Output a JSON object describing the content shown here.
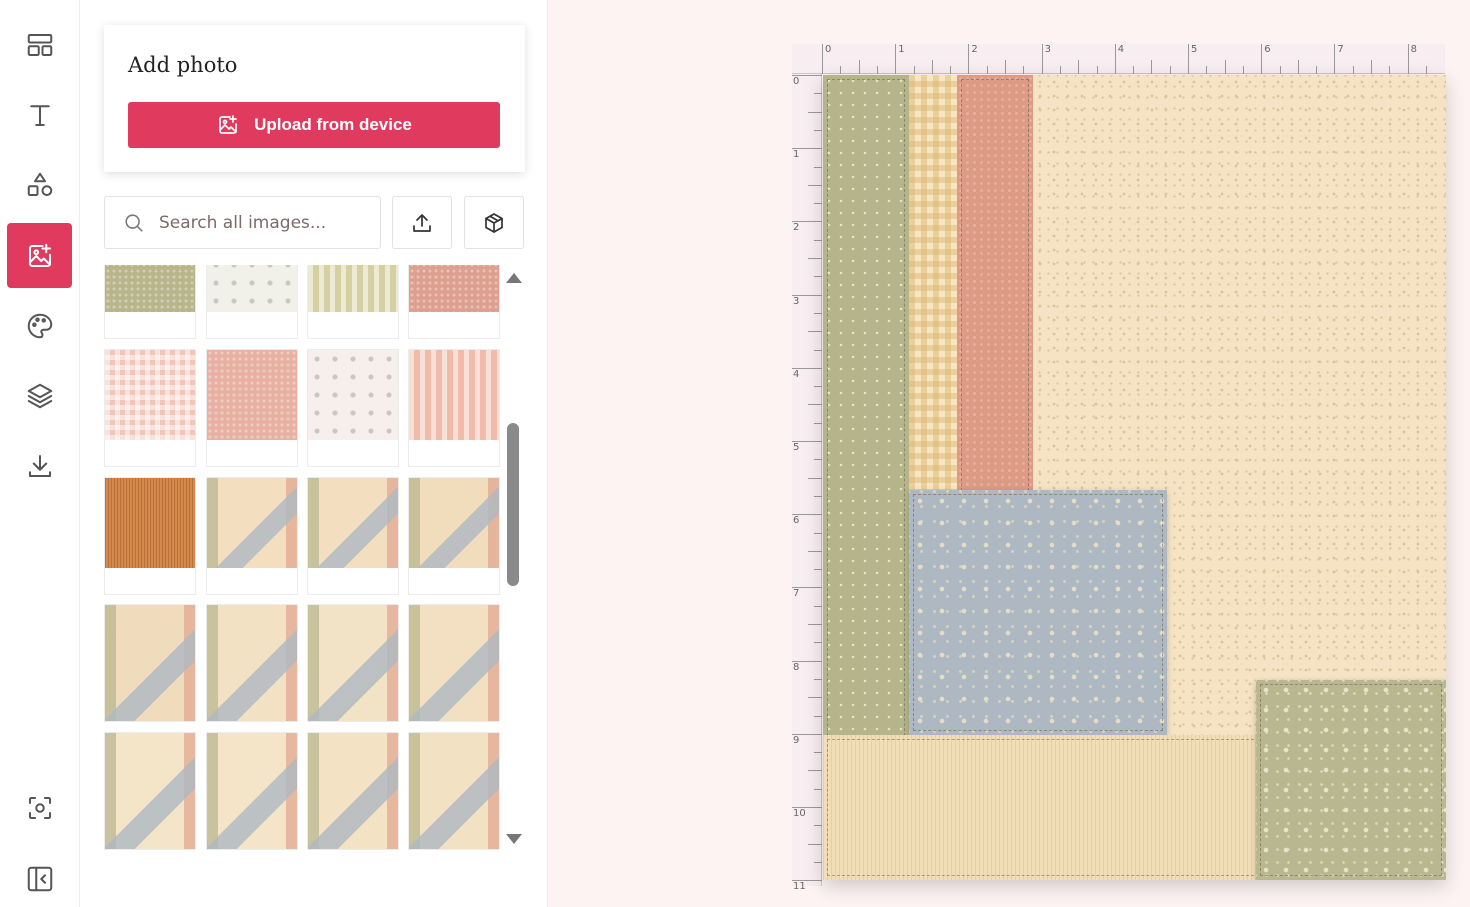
{
  "rail": {
    "items": [
      {
        "name": "templates",
        "icon": "layout-icon",
        "active": false
      },
      {
        "name": "text",
        "icon": "text-icon",
        "active": false
      },
      {
        "name": "elements",
        "icon": "shapes-icon",
        "active": false
      },
      {
        "name": "photos",
        "icon": "image-plus-icon",
        "active": true
      },
      {
        "name": "background",
        "icon": "palette-icon",
        "active": false
      },
      {
        "name": "layers",
        "icon": "layers-icon",
        "active": false
      },
      {
        "name": "download",
        "icon": "download-icon",
        "active": false
      }
    ],
    "bottom": [
      {
        "name": "focus",
        "icon": "focus-icon"
      },
      {
        "name": "collapse",
        "icon": "panel-collapse-icon"
      }
    ],
    "accent": "#e03a5e"
  },
  "panel": {
    "add_photo_title": "Add photo",
    "upload_label": "Upload from device",
    "search_placeholder": "Search all images...",
    "upload_icon": "upload-icon",
    "package_icon": "box-icon",
    "thumbnails": [
      {
        "pattern": "green-floral",
        "color": "#b8b58a"
      },
      {
        "pattern": "snowflake",
        "color": "#f1f1ea"
      },
      {
        "pattern": "green-stripe",
        "color": "#d4d0a2"
      },
      {
        "pattern": "pink-linen",
        "color": "#dea08e"
      },
      {
        "pattern": "pink-gingham",
        "color": "#f2c5b8"
      },
      {
        "pattern": "pink-floral",
        "color": "#e8b0a2"
      },
      {
        "pattern": "pink-snowflake",
        "color": "#f7eeee"
      },
      {
        "pattern": "pink-stripe",
        "color": "#f0bba9"
      },
      {
        "pattern": "orange-cord",
        "color": "#d48a4c"
      },
      {
        "pattern": "layout-1",
        "color": "#f3dfc0"
      },
      {
        "pattern": "layout-2",
        "color": "#f3dfc0"
      },
      {
        "pattern": "layout-3",
        "color": "#f1dcbc"
      },
      {
        "pattern": "layout-4",
        "color": "#f0dcbd"
      },
      {
        "pattern": "layout-5",
        "color": "#f3e1c4"
      },
      {
        "pattern": "layout-6",
        "color": "#f3e3c6"
      },
      {
        "pattern": "layout-7",
        "color": "#f3e0c2"
      },
      {
        "pattern": "layout-8",
        "color": "#f4e4c8"
      },
      {
        "pattern": "layout-9",
        "color": "#f4e4c8"
      },
      {
        "pattern": "layout-10",
        "color": "#f4e2c4"
      },
      {
        "pattern": "layout-11",
        "color": "#f3e1c3"
      }
    ]
  },
  "ruler": {
    "top_labels": [
      "0",
      "1",
      "2",
      "3",
      "4",
      "5",
      "6",
      "7",
      "8"
    ],
    "left_labels": [
      "0",
      "1",
      "2",
      "3",
      "4",
      "5",
      "6",
      "7",
      "8",
      "9",
      "10",
      "11"
    ]
  },
  "page_colors": {
    "background": "#f5e3c4",
    "green": "#b5b58c",
    "gingham": "#f0d9a5",
    "pink": "#dd9b85",
    "blue": "#aeb8c2",
    "sage": "#b9b790",
    "cream": "#f1ddb6"
  }
}
